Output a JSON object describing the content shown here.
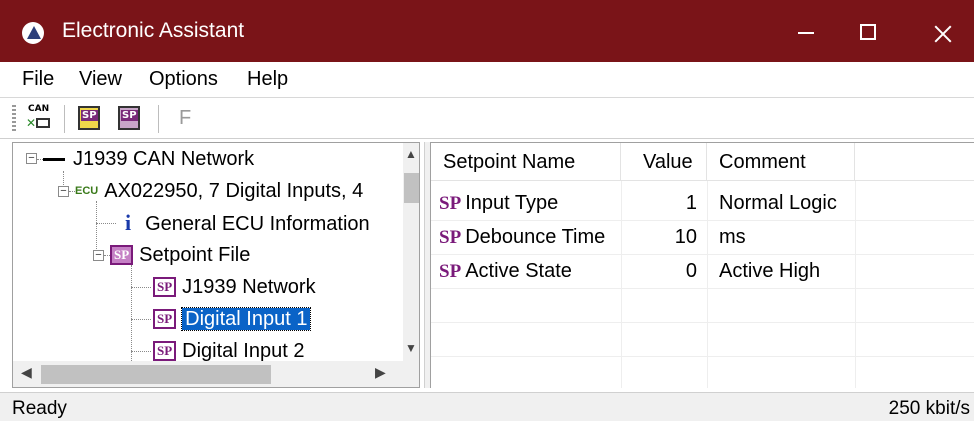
{
  "window": {
    "title": "Electronic Assistant"
  },
  "menu": {
    "items": [
      "File",
      "View",
      "Options",
      "Help"
    ]
  },
  "toolbar": {
    "can_label": "CAN",
    "sp_label": "SP",
    "f_label": "F"
  },
  "tree": {
    "items": [
      {
        "label": "J1939 CAN Network",
        "expander": "−"
      },
      {
        "label": "AX022950, 7 Digital Inputs, 4",
        "badge": "ECU",
        "expander": "−"
      },
      {
        "label": "General ECU Information",
        "icon_text": "i"
      },
      {
        "label": "Setpoint File",
        "icon_text": "SP",
        "expander": "−"
      },
      {
        "label": "J1939 Network",
        "icon_text": "SP"
      },
      {
        "label": "Digital Input 1",
        "icon_text": "SP",
        "selected": true
      },
      {
        "label": "Digital Input 2",
        "icon_text": "SP"
      }
    ]
  },
  "table": {
    "columns": [
      "Setpoint Name",
      "Value",
      "Comment"
    ],
    "rows": [
      {
        "icon": "SP",
        "name": "Input Type",
        "value": "1",
        "comment": "Normal Logic"
      },
      {
        "icon": "SP",
        "name": "Debounce Time",
        "value": "10",
        "comment": "ms"
      },
      {
        "icon": "SP",
        "name": "Active State",
        "value": "0",
        "comment": "Active High"
      }
    ]
  },
  "status": {
    "left": "Ready",
    "right": "250 kbit/s"
  },
  "colors": {
    "titlebar": "#7a1418",
    "selection": "#0a63c7",
    "sp_purple": "#7a1a7a"
  }
}
